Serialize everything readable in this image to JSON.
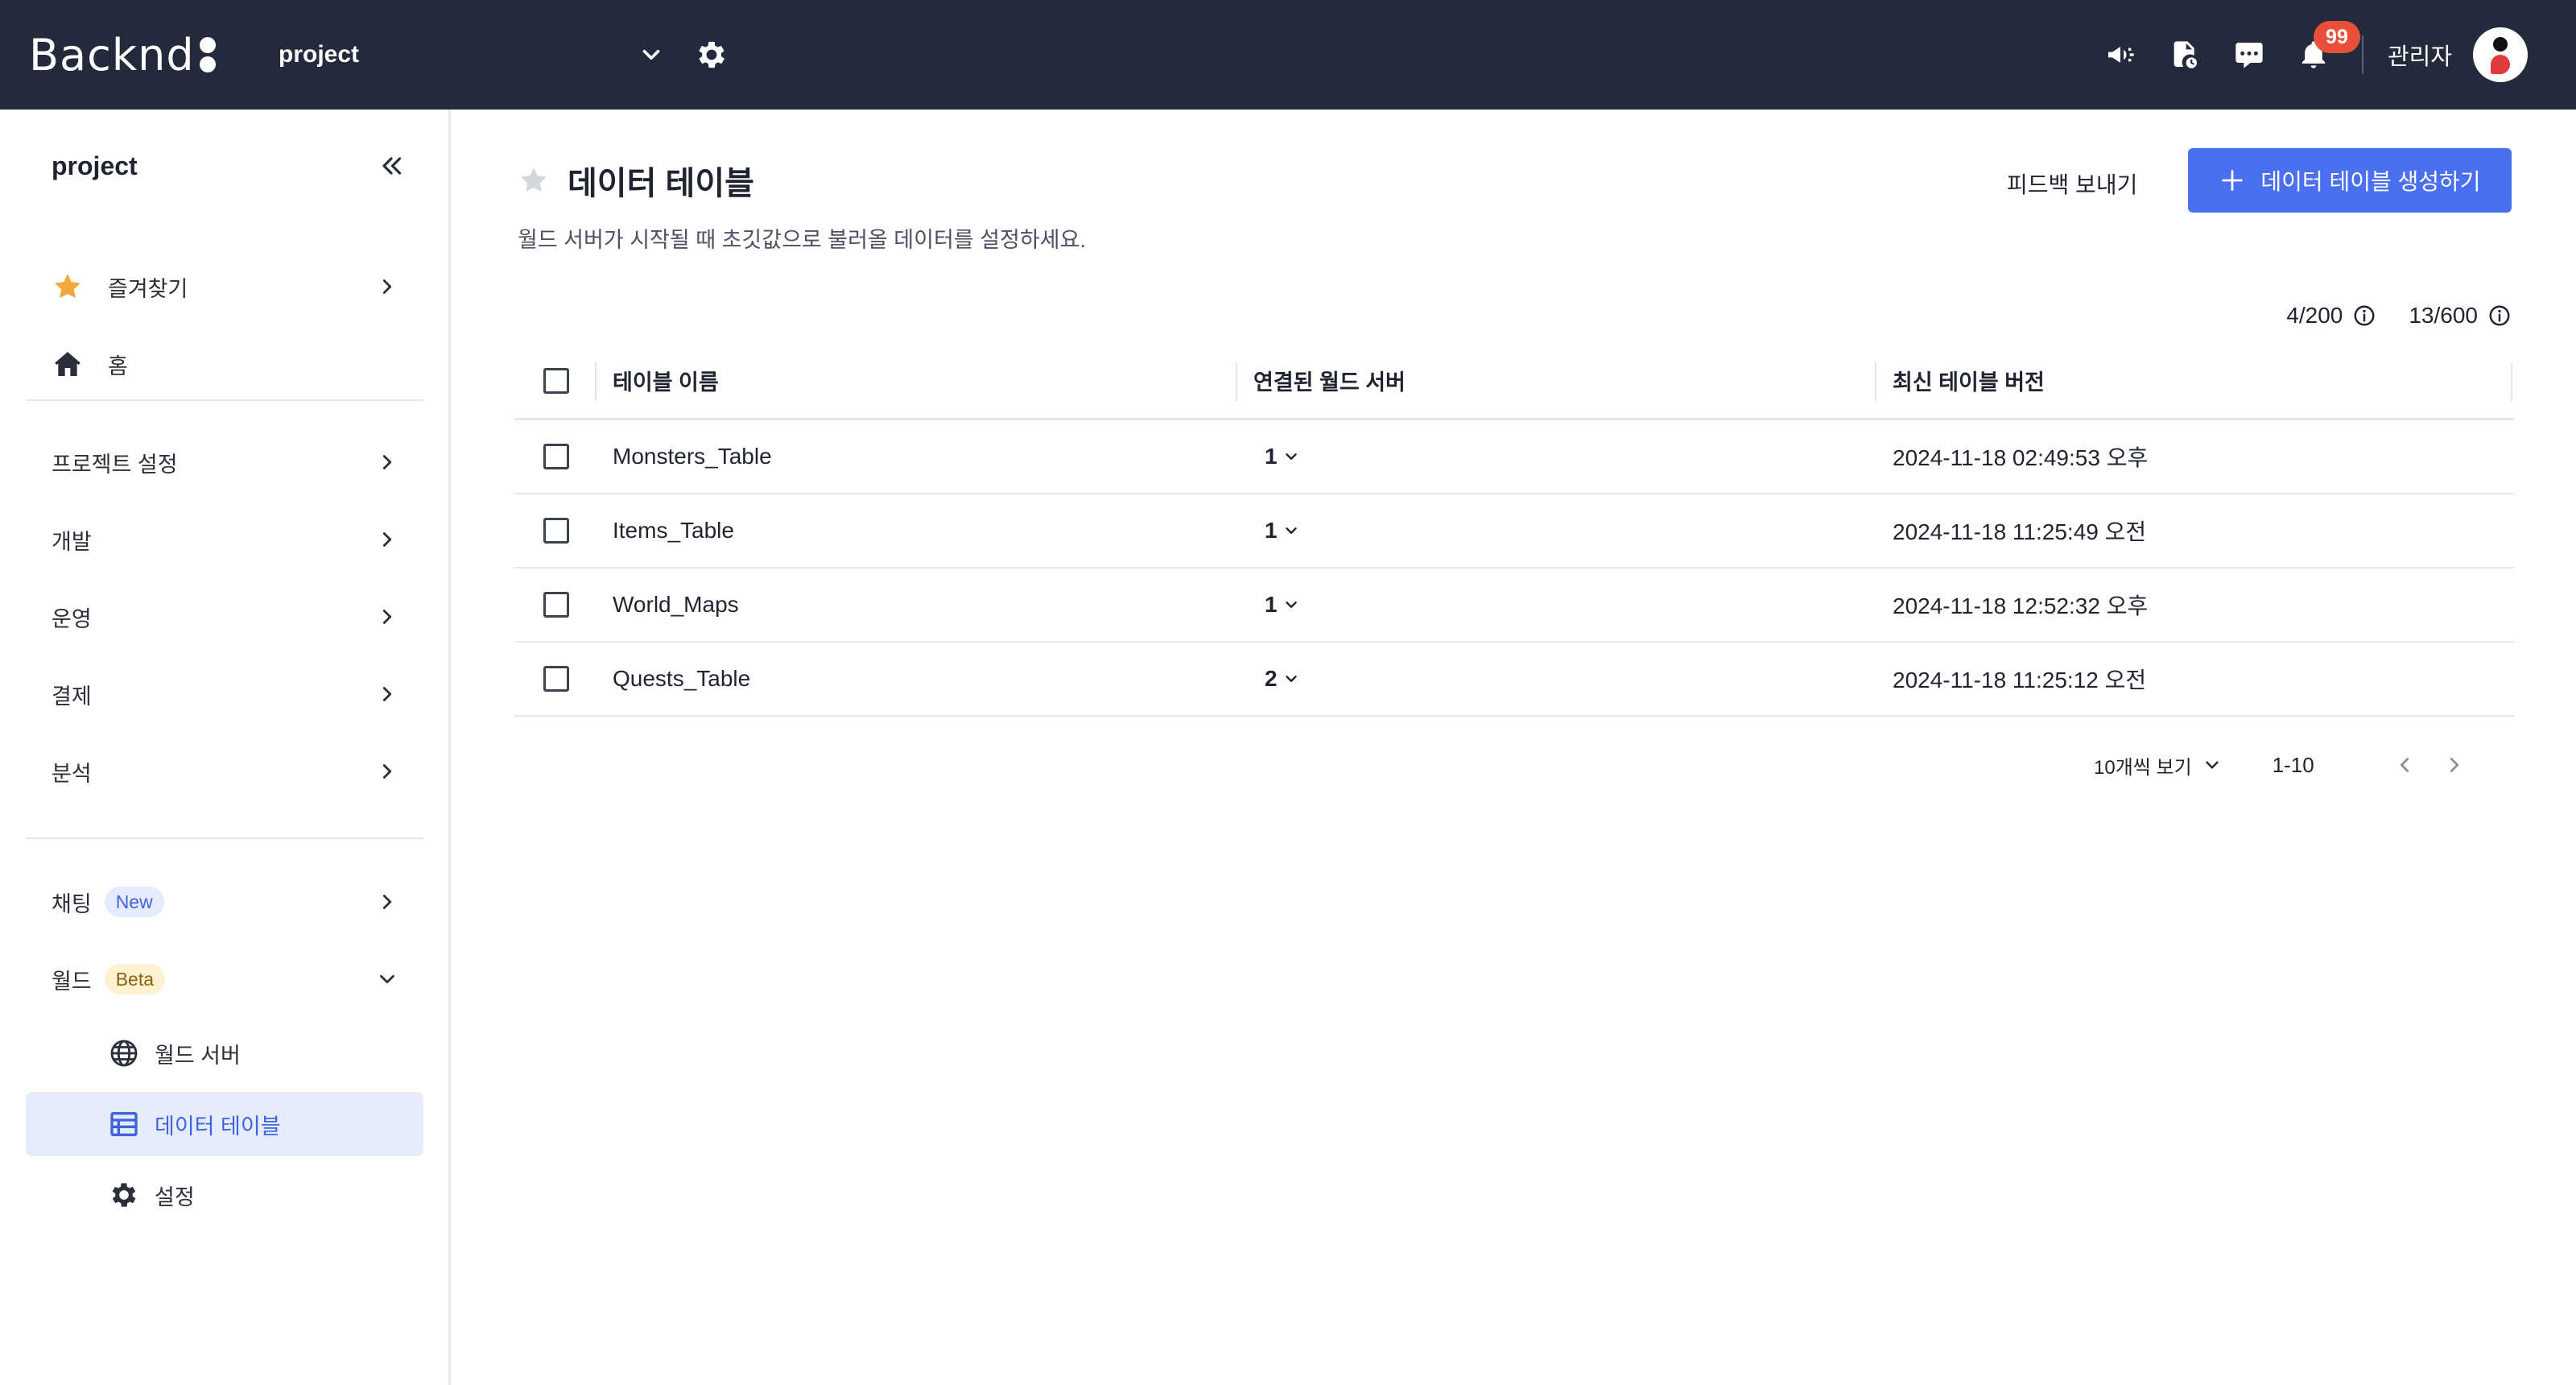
{
  "header": {
    "logo": "Backnd",
    "project": "project",
    "notification_count": "99",
    "admin": "관리자",
    "icons": [
      "megaphone-icon",
      "document-icon",
      "chat-icon",
      "bell-icon"
    ]
  },
  "sidebar": {
    "project": "project",
    "favorites": "즐겨찾기",
    "home": "홈",
    "sections": [
      "프로젝트 설정",
      "개발",
      "운영",
      "결제",
      "분석"
    ],
    "chat": {
      "label": "채팅",
      "badge": "New"
    },
    "world": {
      "label": "월드",
      "badge": "Beta",
      "items": [
        "월드 서버",
        "데이터 테이블",
        "설정"
      ],
      "active": "데이터 테이블"
    }
  },
  "main": {
    "title": "데이터 테이블",
    "subtitle": "월드 서버가 시작될 때 초깃값으로 불러올 데이터를 설정하세요.",
    "feedback": "피드백 보내기",
    "create": "데이터 테이블 생성하기",
    "quota_tables": "4/200",
    "quota_rows": "13/600",
    "columns": [
      "테이블 이름",
      "연결된 월드 서버",
      "최신 테이블 버전"
    ],
    "rows": [
      {
        "name": "Monsters_Table",
        "servers": "1",
        "version": "2024-11-18 02:49:53 오후"
      },
      {
        "name": "Items_Table",
        "servers": "1",
        "version": "2024-11-18 11:25:49 오전"
      },
      {
        "name": "World_Maps",
        "servers": "1",
        "version": "2024-11-18 12:52:32 오후"
      },
      {
        "name": "Quests_Table",
        "servers": "2",
        "version": "2024-11-18 11:25:12 오전"
      }
    ],
    "pagination": {
      "per_page": "10개씩 보기",
      "range": "1-10"
    }
  },
  "colors": {
    "topbar": "#222a3b",
    "primary": "#4a6ff0",
    "badge": "#e8503a",
    "star": "#f2a93b",
    "active_bg": "#e7ecfc"
  }
}
